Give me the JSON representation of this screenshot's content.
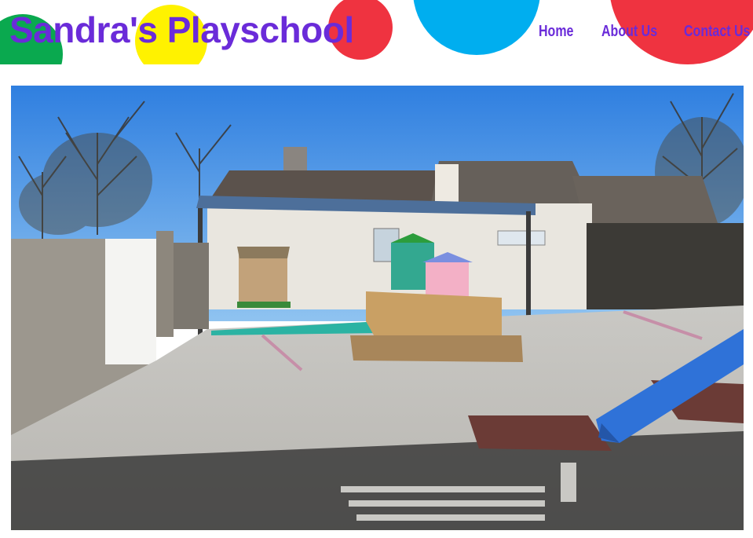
{
  "site": {
    "title": "Sandra's Playschool"
  },
  "nav": {
    "items": [
      "Home",
      "About Us",
      "Contact Us"
    ]
  },
  "brand_colors": {
    "title": "#6a2bd9",
    "green": "#0aa94f",
    "yellow": "#fff200",
    "red": "#ef3340",
    "blue": "#00aeef"
  },
  "hero": {
    "subject": "outdoor-playground-photo"
  }
}
